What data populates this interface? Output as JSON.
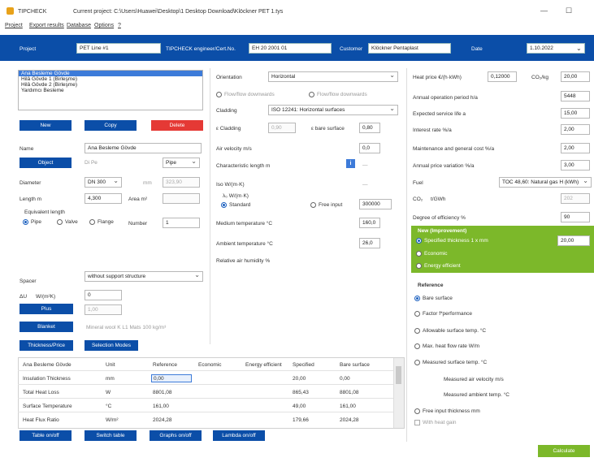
{
  "window": {
    "app_name": "TIPCHECK",
    "title": "Current project:   C:\\Users\\Huawei\\Desktop\\1 Desktop Download\\Klöckner PET 1.tys",
    "minimize": "—",
    "maximize": "☐"
  },
  "menu": [
    "Project",
    "Export results",
    "Database",
    "Options",
    "?"
  ],
  "header": {
    "project_label": "Project",
    "project_value": "PET Line #1",
    "engineer_label": "TIPCHECK engineer/Cert.No.",
    "engineer_value": "EH 20 2001 01",
    "customer_label": "Customer",
    "customer_value": "Klöckner Pentaplast",
    "date_label": "Date",
    "date_value": "1.10.2022"
  },
  "objects": {
    "items": [
      "Ana Besleme Gövde",
      "Hilâ Gövde 1 (Birleşme)",
      "Hilâ Gövde 2 (Birleşme)",
      "Yardımcı Besleme"
    ],
    "selected_index": 0,
    "new_label": "New",
    "copy_label": "Copy",
    "delete_label": "Delete"
  },
  "object_form": {
    "name_label": "Name",
    "name_value": "Ana Besleme Gövde",
    "object_button": "Object",
    "object_code": "Di Pe",
    "object_type": "Pipe",
    "diameter_label": "Diameter",
    "diameter_value": "DN 300",
    "diameter_unit": "mm",
    "diameter_mm": "323,90",
    "length_label": "Length m",
    "length_value": "4,300",
    "area_label": "Area m²",
    "equiv_label": "Equivalent length",
    "pipe_label": "Pipe",
    "valve_label": "Valve",
    "flange_label": "Flange",
    "number_label": "Number",
    "number_value": "1"
  },
  "support": {
    "label": "Spacer",
    "value": "without support structure",
    "u_label": "ΔU",
    "w_label": "W/(m²K)",
    "w_value": "0",
    "plus_button": "Plus",
    "plus_value": "1,00",
    "blanket_button": "Blanket",
    "blanket_text": "Mineral wool K L1 Mats  100 kg/m³",
    "thickness_button": "Thickness/Price",
    "selection_button": "Selection Modes"
  },
  "conditions": {
    "orientation_label": "Orientation",
    "orientation_value": "Horizontal",
    "flow_horizontal": "Flow/flow downwards",
    "flow_vertical": "Flow/flow downwards",
    "cladding_label": "Cladding",
    "cladding_value": "ISO 12241: Horizontal surfaces",
    "e_cladding_label": "ε Cladding",
    "e_cladding_value": "0,90",
    "e_surface_label": "ε bare surface",
    "e_surface_value": "0,80",
    "air_velocity_label": "Air velocity m/s",
    "air_velocity_value": "0,0",
    "char_length_label": "Characteristic length m",
    "char_length_value": "—",
    "info_icon_text": "i",
    "iso_label": "Iso W/(m·K)",
    "iso_value": "—",
    "standard_sub_label": "λ₀ W/(m·K)",
    "standard_label": "Standard",
    "free_input_label": "Free input",
    "free_input_value": "300000",
    "medium_temp_label": "Medium temperature °C",
    "medium_temp_value": "160,0",
    "ambient_temp_label": "Ambient temperature °C",
    "ambient_temp_value": "26,0",
    "humidity_label": "Relative air humidity %"
  },
  "economics": {
    "heat_price_label": "Heat price €/(h·kWh)",
    "heat_price_value": "0,12000",
    "co2_label": "CO₂/kg",
    "co2_value": "20,00",
    "operation_label": "Annual operation period h/a",
    "operation_value": "5448",
    "service_life_label": "Expected service life a",
    "service_life_value": "15,00",
    "interest_label": "Interest rate %/a",
    "interest_value": "2,00",
    "maintenance_label": "Maintenance and general cost %/a",
    "maintenance_value": "2,00",
    "price_var_label": "Annual price variation %/a",
    "price_var_value": "3,00",
    "fuel_label": "Fuel",
    "fuel_value": "TOC 48,60: Natural gas H (kWh)",
    "co2_unit_label": "CO₂",
    "co2_unit": "t/GWh",
    "co2_unit_value": "202",
    "efficiency_label": "Degree of efficiency %",
    "efficiency_value": "90"
  },
  "new_improvement": {
    "title": "New (Improvement)",
    "specified_label": "Specified thickness 1 x mm",
    "specified_value": "20,00",
    "economic_label": "Economic",
    "energy_label": "Energy efficient"
  },
  "reference": {
    "title": "Reference",
    "bare_label": "Bare surface",
    "factor_label": "Factor f*performance",
    "allowable_label": "Allowable surface temp. °C",
    "maxheat_label": "Max. heat flow rate W/m",
    "measured_label": "Measured surface temp. °C",
    "measured_air_label": "Measured air velocity m/s",
    "measured_amb_label": "Measured ambient temp. °C",
    "free_thickness_label": "Free input thickness mm",
    "with_heat_gain_label": "With heat gain"
  },
  "results": {
    "columns": [
      "Ana Besleme Gövde",
      "Unit",
      "Reference",
      "Economic",
      "Energy efficient",
      "Specified",
      "Bare surface"
    ],
    "rows": [
      {
        "name": "Insulation Thickness",
        "unit": "mm",
        "reference": "0,00",
        "economic": "",
        "energy": "",
        "specified": "20,00",
        "bare": "0,00"
      },
      {
        "name": "Total Heat Loss",
        "unit": "W",
        "reference": "8801,08",
        "economic": "",
        "energy": "",
        "specified": "865,43",
        "bare": "8801,08"
      },
      {
        "name": "Surface Temperature",
        "unit": "°C",
        "reference": "161,00",
        "economic": "",
        "energy": "",
        "specified": "49,00",
        "bare": "161,00"
      },
      {
        "name": "Heat Flux Ratio",
        "unit": "W/m²",
        "reference": "2024,28",
        "economic": "",
        "energy": "",
        "specified": "179,66",
        "bare": "2024,28"
      }
    ],
    "table_button": "Table on/off",
    "switch_button": "Switch table",
    "graphs_button": "Graphs on/off",
    "lambda_button": "Lambda on/off",
    "calculate_button": "Calculate"
  },
  "colors": {
    "accent": "#0b4ea8",
    "delete": "#e53935",
    "green": "#7cb82a"
  }
}
